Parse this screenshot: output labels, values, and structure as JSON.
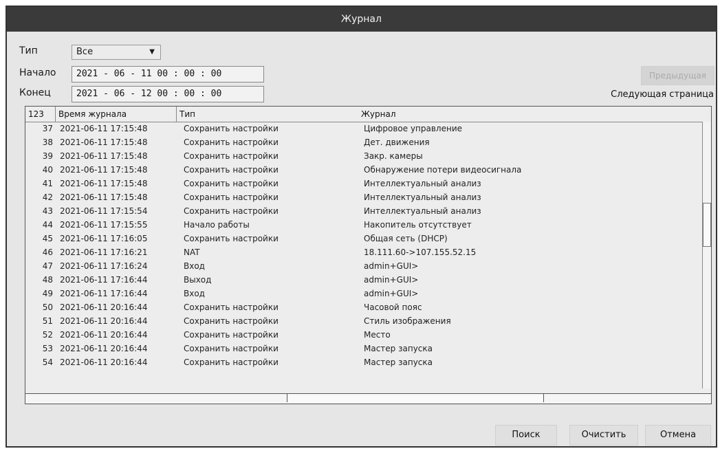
{
  "window": {
    "title": "Журнал"
  },
  "filters": {
    "type_label": "Тип",
    "type_value": "Все",
    "start_label": "Начало",
    "start_value": "2021 - 06 - 11  00 : 00 : 00",
    "end_label": "Конец",
    "end_value": "2021 - 06 - 12  00 : 00 : 00"
  },
  "controls": {
    "prev_page": "Предыдущая",
    "next_page": "Следующая страница"
  },
  "table": {
    "headers": [
      "123",
      "Время журнала",
      "Тип",
      "Журнал"
    ],
    "rows": [
      [
        "37",
        "2021-06-11 17:15:48",
        "Сохранить настройки",
        "Цифровое управление"
      ],
      [
        "38",
        "2021-06-11 17:15:48",
        "Сохранить настройки",
        "Дет. движения"
      ],
      [
        "39",
        "2021-06-11 17:15:48",
        "Сохранить настройки",
        "Закр. камеры"
      ],
      [
        "40",
        "2021-06-11 17:15:48",
        "Сохранить настройки",
        "Обнаружение потери видеосигнала"
      ],
      [
        "41",
        "2021-06-11 17:15:48",
        "Сохранить настройки",
        "Интеллектуальный анализ"
      ],
      [
        "42",
        "2021-06-11 17:15:48",
        "Сохранить настройки",
        "Интеллектуальный анализ"
      ],
      [
        "43",
        "2021-06-11 17:15:54",
        "Сохранить настройки",
        "Интеллектуальный анализ"
      ],
      [
        "44",
        "2021-06-11 17:15:55",
        "Начало работы",
        "Накопитель отсутствует"
      ],
      [
        "45",
        "2021-06-11 17:16:05",
        "Сохранить настройки",
        "Общая сеть (DHCP)"
      ],
      [
        "46",
        "2021-06-11 17:16:21",
        "NAT",
        "18.111.60->107.155.52.15"
      ],
      [
        "47",
        "2021-06-11 17:16:24",
        "Вход",
        "admin+GUI>"
      ],
      [
        "48",
        "2021-06-11 17:16:44",
        "Выход",
        "admin+GUI>"
      ],
      [
        "49",
        "2021-06-11 17:16:44",
        "Вход",
        "admin+GUI>"
      ],
      [
        "50",
        "2021-06-11 20:16:44",
        "Сохранить настройки",
        "Часовой пояс"
      ],
      [
        "51",
        "2021-06-11 20:16:44",
        "Сохранить настройки",
        "Стиль изображения"
      ],
      [
        "52",
        "2021-06-11 20:16:44",
        "Сохранить настройки",
        "Место"
      ],
      [
        "53",
        "2021-06-11 20:16:44",
        "Сохранить настройки",
        "Мастер запуска"
      ],
      [
        "54",
        "2021-06-11 20:16:44",
        "Сохранить настройки",
        "Мастер запуска"
      ]
    ]
  },
  "buttons": {
    "search": "Поиск",
    "clear": "Очистить",
    "cancel": "Отмена"
  },
  "icons": {
    "dropdown": "chevron-down-icon"
  }
}
